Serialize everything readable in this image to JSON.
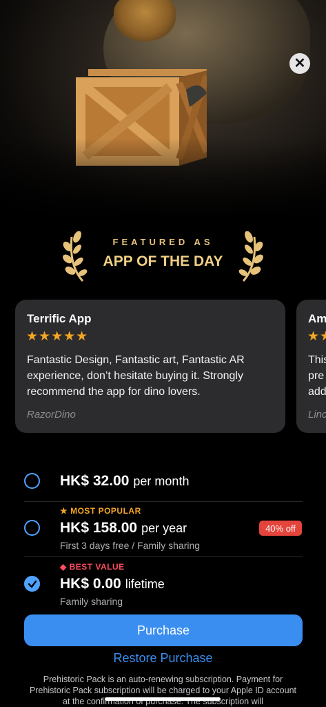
{
  "award": {
    "line1": "FEATURED AS",
    "line2": "APP OF THE DAY"
  },
  "reviews": [
    {
      "title": "Terrific App",
      "stars": "★★★★★",
      "body": "Fantastic Design, Fantastic art, Fantastic AR experience, don’t hesitate buying it. Strongly recommend the app for dino lovers.",
      "author": "RazorDino"
    },
    {
      "title": "Am",
      "stars": "★★",
      "body_lines": [
        "This",
        "pre",
        "add"
      ],
      "author": "Linc"
    }
  ],
  "plans": [
    {
      "price": "HK$ 32.00",
      "period": "per month",
      "selected": false
    },
    {
      "tag": "★ MOST POPULAR",
      "price": "HK$ 158.00",
      "period": "per year",
      "note": "First 3 days free / Family sharing",
      "badge": "40% off",
      "selected": false
    },
    {
      "tag": "◆ BEST VALUE",
      "price": "HK$ 0.00",
      "period": "lifetime",
      "note": "Family sharing",
      "selected": true
    }
  ],
  "buttons": {
    "purchase": "Purchase",
    "restore": "Restore Purchase"
  },
  "legal": "Prehistoric Pack is an auto-renewing subscription. Payment for Prehistoric Pack subscription will be charged to your Apple ID account at the confirmation of purchase. The subscription will",
  "colors": {
    "accent": "#3a8ef0",
    "gold": "#f0cf85",
    "popular": "#f5a623",
    "best_value": "#ff4d5e",
    "discount": "#e5443c"
  }
}
